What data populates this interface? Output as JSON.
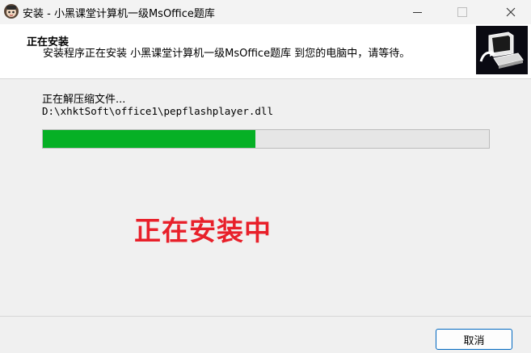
{
  "window": {
    "title": "安装 - 小黑课堂计算机一级MsOffice题库",
    "controls": {
      "minimize_icon": "minimize-icon",
      "maximize_icon": "maximize-icon",
      "close_icon": "close-icon"
    }
  },
  "header": {
    "title": "正在安装",
    "description": "安装程序正在安装 小黑课堂计算机一级MsOffice题库 到您的电脑中，请等待。",
    "logo_icon": "installer-computer-icon"
  },
  "main": {
    "status_text": "正在解压缩文件...",
    "file_path": "D:\\xhktSoft\\office1\\pepflashplayer.dll",
    "progress_fraction": 0.476,
    "progress_color": "#06b025",
    "installing_label": "正在安装中",
    "installing_label_color": "#e8202a"
  },
  "footer": {
    "cancel_label": "取消",
    "cancel_border_color": "#0067c0"
  }
}
